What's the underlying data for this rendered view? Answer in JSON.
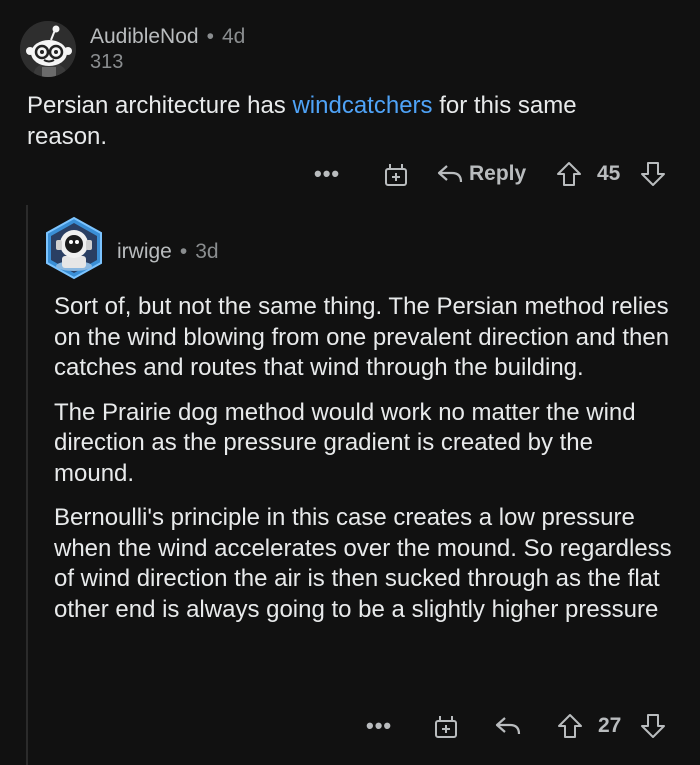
{
  "comments": [
    {
      "username": "AudibleNod",
      "separator": "•",
      "age": "4d",
      "karma": "313",
      "body_before": "Persian architecture has ",
      "body_link": "windcatchers",
      "body_after": " for this same reason.",
      "actions": {
        "more": "•••",
        "award_icon": "gift-icon",
        "reply_icon": "reply-arrow-icon",
        "reply_label": "Reply",
        "upvote_icon": "upvote-arrow-icon",
        "score": "45",
        "downvote_icon": "downvote-arrow-icon"
      }
    },
    {
      "username": "irwige",
      "separator": "•",
      "age": "3d",
      "paragraphs": [
        "Sort of, but not the same thing. The Persian method relies on the wind blowing from one prevalent direction and then catches and routes that wind through the building.",
        "The Prairie dog method would work no matter the wind direction as the pressure gradient is created by the mound.",
        "Bernoulli's principle in this case creates a low pressure when the wind accelerates over the mound. So regardless of wind direction the air is then sucked through as the flat other end is always going to be a slightly higher pressure"
      ],
      "actions": {
        "more": "•••",
        "award_icon": "gift-icon",
        "reply_icon": "reply-arrow-icon",
        "upvote_icon": "upvote-arrow-icon",
        "score": "27",
        "downvote_icon": "downvote-arrow-icon"
      }
    }
  ],
  "colors": {
    "background": "#111111",
    "text": "#e8eaeb",
    "muted": "#8a8d8f",
    "link": "#4fa3f7",
    "thread_line": "#2b2b2b"
  }
}
